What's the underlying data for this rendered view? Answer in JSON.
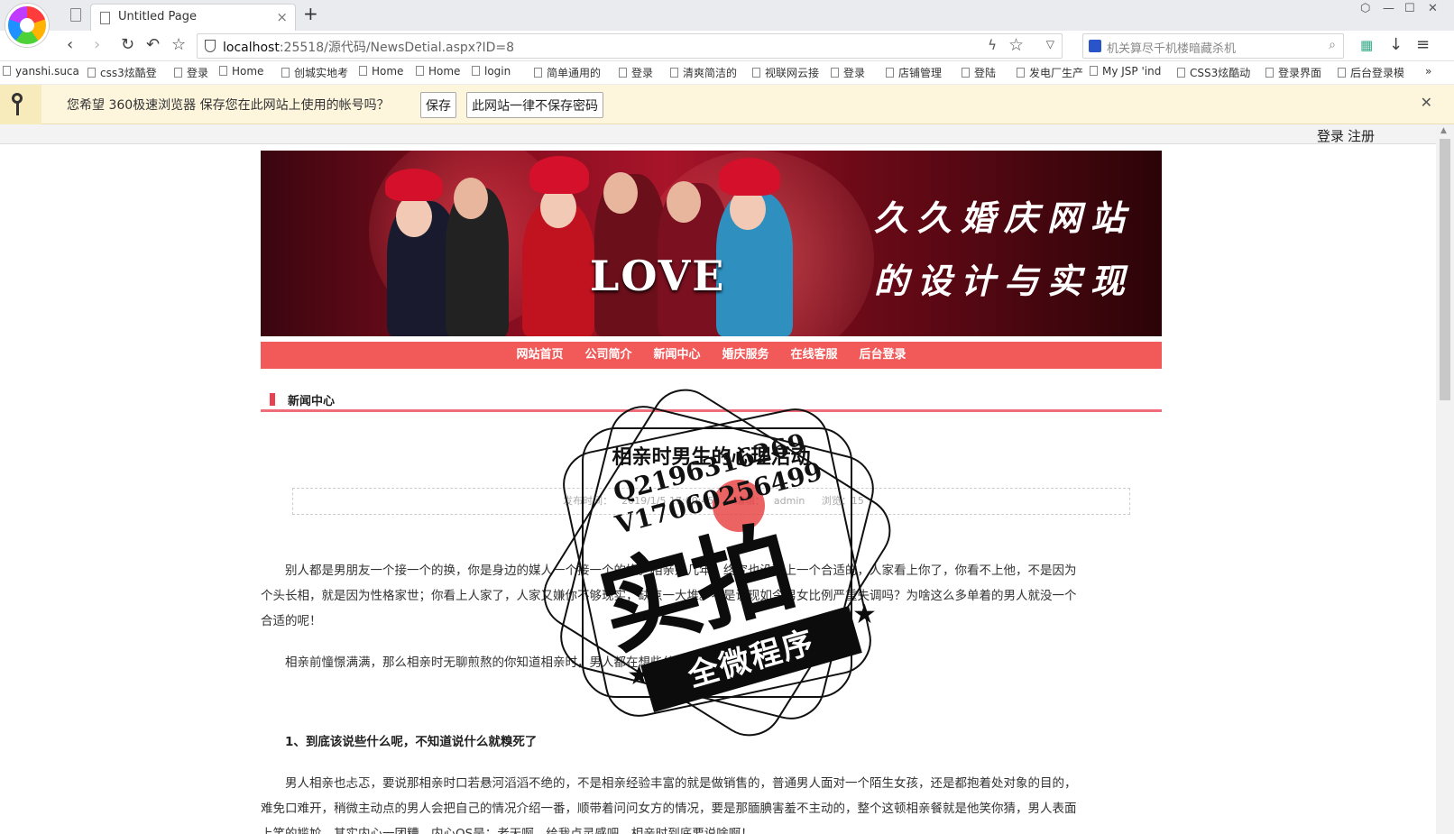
{
  "browser": {
    "tab_title": "Untitled Page",
    "tab_close": "×",
    "new_tab": "+",
    "url_host": "localhost",
    "url_path": ":25518/源代码/NewsDetial.aspx?ID=8",
    "search_placeholder": "机关算尽千机楼暗藏杀机",
    "bookmarks": [
      "yanshi.suca",
      "css3炫酷登",
      "登录",
      "Home",
      "创城实地考",
      "Home",
      "Home",
      "login",
      "简单通用的",
      "登录",
      "清爽简洁的",
      "视联网云接",
      "登录",
      "店铺管理",
      "登陆",
      "发电厂生产",
      "My JSP 'ind",
      "CSS3炫酷动",
      "登录界面",
      "后台登录模"
    ],
    "bookmarks_more": "»"
  },
  "password_bar": {
    "message": "您希望 360极速浏览器 保存您在此网站上使用的帐号吗？",
    "save": "保存",
    "never": "此网站一律不保存密码",
    "close": "✕"
  },
  "site": {
    "login": "登录",
    "register": "注册",
    "banner_love": "LOVE",
    "banner_title_1": "久久婚庆网站",
    "banner_title_2": "的设计与实现",
    "menu": [
      "网站首页",
      "公司简介",
      "新闻中心",
      "婚庆服务",
      "在线客服",
      "后台登录"
    ],
    "section_title": "新闻中心"
  },
  "article": {
    "title": "相亲时男生的心理活动",
    "meta_time_label": "发布时间：",
    "meta_time": "2019/1/5 17:00:45",
    "meta_editor_label": "编辑：",
    "meta_editor": "admin",
    "meta_views": "浏览：15",
    "paragraphs": [
      "别人都是男朋友一个接一个的换，你是身边的媒人一个接一个的换。相亲好几年，终究也没碰上一个合适的，人家看上你了，你看不上他，不是因为个头长相，就是因为性格家世；你看上人家了，人家又嫌你不够现实，缺点一大堆。不是说现如今男女比例严重失调吗？为啥这么多单着的男人就没一个合适的呢！",
      "相亲前憧憬满满，那么相亲时无聊煎熬的你知道相亲时，男人都在想些什么吗？",
      "1、到底该说些什么呢，不知道说什么就糗死了",
      "男人相亲也忐忑，要说那相亲时口若悬河滔滔不绝的，不是相亲经验丰富的就是做销售的，普通男人面对一个陌生女孩，还是都抱着处对象的目的，难免口难开，稍微主动点的男人会把自己的情况介绍一番，顺带着问问女方的情况，要是那腼腆害羞不主动的，整个这顿相亲餐就是他笑你猜，男人表面上笑的尴尬，其实内心一团糟，内心OS是：老天啊，给我点灵感吧，相亲时到底要说啥啊！"
    ]
  },
  "watermark": {
    "qq": "Q2196316269",
    "vx": "V17060256499",
    "big": "实拍",
    "ribbon": "全微程序"
  }
}
